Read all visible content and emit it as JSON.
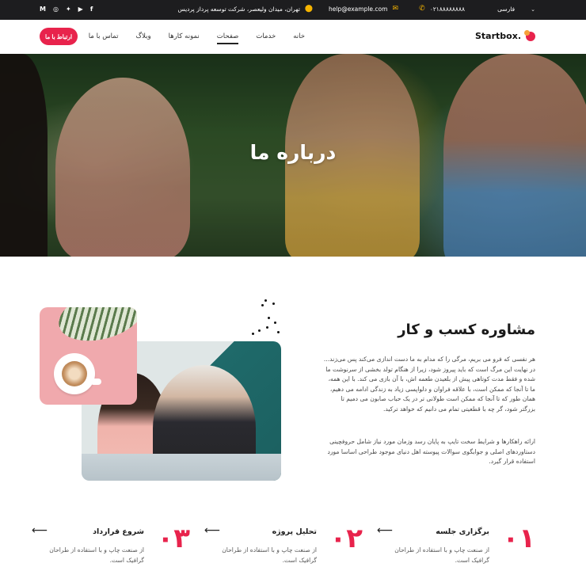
{
  "topbar": {
    "language": "فارسی",
    "phone": "۰۲۱۸۸۸۸۸۸۸۸",
    "email": "help@example.com",
    "address": "تهران، میدان ولیعصر، شرکت توسعه پرداز پردیس",
    "socials": [
      "facebook-icon",
      "youtube-icon",
      "twitter-icon",
      "instagram-icon",
      "gmail-icon"
    ]
  },
  "nav": {
    "logo": "Startbox.",
    "menu": [
      "خانه",
      "خدمات",
      "صفحات",
      "نمونه کارها",
      "وبلاگ",
      "تماس با ما"
    ],
    "active": "صفحات",
    "cta": "ارتباط با ما"
  },
  "hero": {
    "title": "درباره ما"
  },
  "about": {
    "title": "مشاوره کسب و کار",
    "paragraph1": "هر نفسی که فرو می بریم، مرگی را که مدام به ما دست اندازی می‌کند پس می‌زند... در نهایت این مرگ است که باید پیروز شود، زیرا از هنگام تولد بخشی از سرنوشت ما شده و فقط مدت کوتاهی پیش از بلعیدن طعمه اش، با آن بازی می کند. با این همه، ما تا آنجا که ممکن است، با علاقه فراوان و دلواپسی زیاد به زندگی ادامه می دهیم، همان طور که تا آنجا که ممکن است طولانی تر در یک حباب صابون می دمیم تا بزرگتر شود، گر چه با قطعیتی تمام می دانیم که خواهد ترکید.",
    "paragraph2": "ارائه راهکارها و شرایط سخت تایپ به پایان رسد وزمان مورد نیاز شامل حروفچینی دستاوردهای اصلی و جوابگوی سوالات پیوسته اهل دنیای موجود طراحی اساسا مورد استفاده قرار گیرد."
  },
  "steps": [
    {
      "number": "۰۱",
      "title": "برگزاری جلسه",
      "desc": "از صنعت چاپ و با استفاده از طراحان گرافیک است."
    },
    {
      "number": "۰۲",
      "title": "تحلیل پروژه",
      "desc": "از صنعت چاپ و با استفاده از طراحان گرافیک است."
    },
    {
      "number": "۰۳",
      "title": "شروع قرارداد",
      "desc": "از صنعت چاپ و با استفاده از طراحان گرافیک است."
    }
  ],
  "colors": {
    "accent": "#e8234c",
    "topbar_bg": "#1d1d1f",
    "icon_yellow": "#f5b400"
  }
}
